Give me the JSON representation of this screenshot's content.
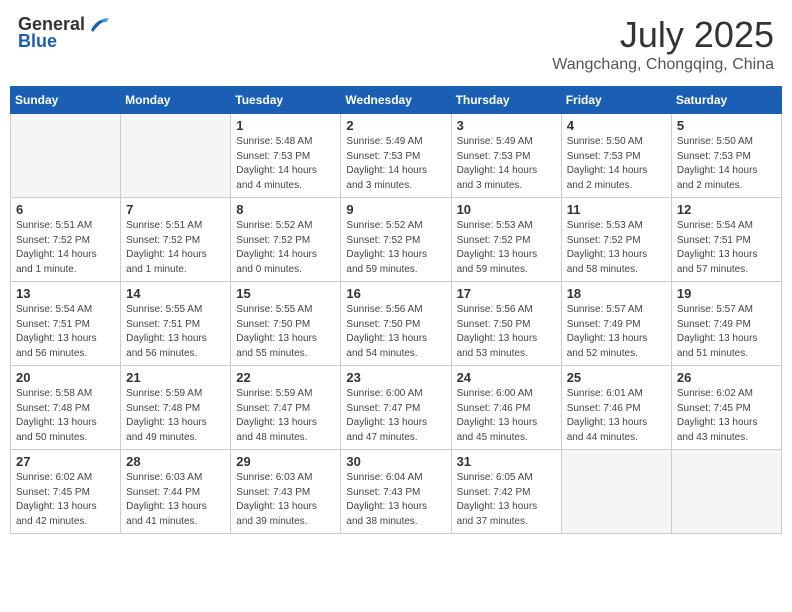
{
  "logo": {
    "general": "General",
    "blue": "Blue"
  },
  "title": "July 2025",
  "location": "Wangchang, Chongqing, China",
  "days_of_week": [
    "Sunday",
    "Monday",
    "Tuesday",
    "Wednesday",
    "Thursday",
    "Friday",
    "Saturday"
  ],
  "weeks": [
    [
      {
        "day": "",
        "info": ""
      },
      {
        "day": "",
        "info": ""
      },
      {
        "day": "1",
        "info": "Sunrise: 5:48 AM\nSunset: 7:53 PM\nDaylight: 14 hours and 4 minutes."
      },
      {
        "day": "2",
        "info": "Sunrise: 5:49 AM\nSunset: 7:53 PM\nDaylight: 14 hours and 3 minutes."
      },
      {
        "day": "3",
        "info": "Sunrise: 5:49 AM\nSunset: 7:53 PM\nDaylight: 14 hours and 3 minutes."
      },
      {
        "day": "4",
        "info": "Sunrise: 5:50 AM\nSunset: 7:53 PM\nDaylight: 14 hours and 2 minutes."
      },
      {
        "day": "5",
        "info": "Sunrise: 5:50 AM\nSunset: 7:53 PM\nDaylight: 14 hours and 2 minutes."
      }
    ],
    [
      {
        "day": "6",
        "info": "Sunrise: 5:51 AM\nSunset: 7:52 PM\nDaylight: 14 hours and 1 minute."
      },
      {
        "day": "7",
        "info": "Sunrise: 5:51 AM\nSunset: 7:52 PM\nDaylight: 14 hours and 1 minute."
      },
      {
        "day": "8",
        "info": "Sunrise: 5:52 AM\nSunset: 7:52 PM\nDaylight: 14 hours and 0 minutes."
      },
      {
        "day": "9",
        "info": "Sunrise: 5:52 AM\nSunset: 7:52 PM\nDaylight: 13 hours and 59 minutes."
      },
      {
        "day": "10",
        "info": "Sunrise: 5:53 AM\nSunset: 7:52 PM\nDaylight: 13 hours and 59 minutes."
      },
      {
        "day": "11",
        "info": "Sunrise: 5:53 AM\nSunset: 7:52 PM\nDaylight: 13 hours and 58 minutes."
      },
      {
        "day": "12",
        "info": "Sunrise: 5:54 AM\nSunset: 7:51 PM\nDaylight: 13 hours and 57 minutes."
      }
    ],
    [
      {
        "day": "13",
        "info": "Sunrise: 5:54 AM\nSunset: 7:51 PM\nDaylight: 13 hours and 56 minutes."
      },
      {
        "day": "14",
        "info": "Sunrise: 5:55 AM\nSunset: 7:51 PM\nDaylight: 13 hours and 56 minutes."
      },
      {
        "day": "15",
        "info": "Sunrise: 5:55 AM\nSunset: 7:50 PM\nDaylight: 13 hours and 55 minutes."
      },
      {
        "day": "16",
        "info": "Sunrise: 5:56 AM\nSunset: 7:50 PM\nDaylight: 13 hours and 54 minutes."
      },
      {
        "day": "17",
        "info": "Sunrise: 5:56 AM\nSunset: 7:50 PM\nDaylight: 13 hours and 53 minutes."
      },
      {
        "day": "18",
        "info": "Sunrise: 5:57 AM\nSunset: 7:49 PM\nDaylight: 13 hours and 52 minutes."
      },
      {
        "day": "19",
        "info": "Sunrise: 5:57 AM\nSunset: 7:49 PM\nDaylight: 13 hours and 51 minutes."
      }
    ],
    [
      {
        "day": "20",
        "info": "Sunrise: 5:58 AM\nSunset: 7:48 PM\nDaylight: 13 hours and 50 minutes."
      },
      {
        "day": "21",
        "info": "Sunrise: 5:59 AM\nSunset: 7:48 PM\nDaylight: 13 hours and 49 minutes."
      },
      {
        "day": "22",
        "info": "Sunrise: 5:59 AM\nSunset: 7:47 PM\nDaylight: 13 hours and 48 minutes."
      },
      {
        "day": "23",
        "info": "Sunrise: 6:00 AM\nSunset: 7:47 PM\nDaylight: 13 hours and 47 minutes."
      },
      {
        "day": "24",
        "info": "Sunrise: 6:00 AM\nSunset: 7:46 PM\nDaylight: 13 hours and 45 minutes."
      },
      {
        "day": "25",
        "info": "Sunrise: 6:01 AM\nSunset: 7:46 PM\nDaylight: 13 hours and 44 minutes."
      },
      {
        "day": "26",
        "info": "Sunrise: 6:02 AM\nSunset: 7:45 PM\nDaylight: 13 hours and 43 minutes."
      }
    ],
    [
      {
        "day": "27",
        "info": "Sunrise: 6:02 AM\nSunset: 7:45 PM\nDaylight: 13 hours and 42 minutes."
      },
      {
        "day": "28",
        "info": "Sunrise: 6:03 AM\nSunset: 7:44 PM\nDaylight: 13 hours and 41 minutes."
      },
      {
        "day": "29",
        "info": "Sunrise: 6:03 AM\nSunset: 7:43 PM\nDaylight: 13 hours and 39 minutes."
      },
      {
        "day": "30",
        "info": "Sunrise: 6:04 AM\nSunset: 7:43 PM\nDaylight: 13 hours and 38 minutes."
      },
      {
        "day": "31",
        "info": "Sunrise: 6:05 AM\nSunset: 7:42 PM\nDaylight: 13 hours and 37 minutes."
      },
      {
        "day": "",
        "info": ""
      },
      {
        "day": "",
        "info": ""
      }
    ]
  ]
}
